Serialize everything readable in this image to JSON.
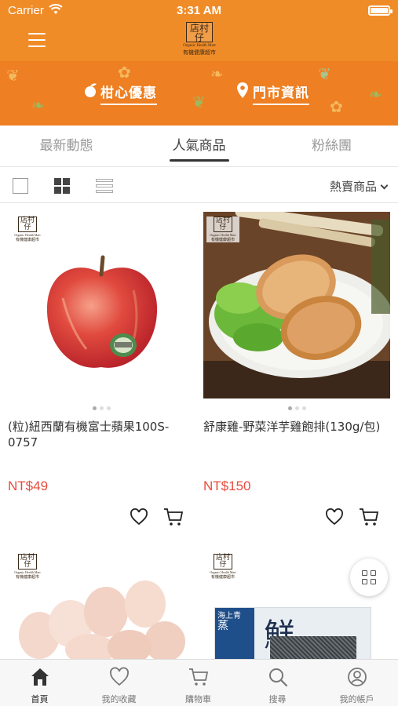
{
  "status_bar": {
    "carrier": "Carrier",
    "time": "3:31 AM"
  },
  "header": {
    "logo_mark": "店村仔",
    "logo_en": "Organic Health Mart",
    "logo_zh": "有機健康超市"
  },
  "banner": {
    "left_link": "柑心優惠",
    "right_link": "門市資訊"
  },
  "tabs": [
    {
      "label": "最新動態"
    },
    {
      "label": "人氣商品"
    },
    {
      "label": "粉絲團"
    }
  ],
  "active_tab": 1,
  "toolbar": {
    "sort_label": "熱賣商品"
  },
  "products": [
    {
      "name": "(粒)紐西蘭有機富士蘋果100S-0757",
      "price": "NT$49"
    },
    {
      "name": "舒康雞-野菜洋芋雞飽排(130g/包)",
      "price": "NT$150"
    },
    {
      "name": "",
      "price": ""
    },
    {
      "name": "",
      "price": ""
    }
  ],
  "package_label": {
    "brand": "海上青",
    "big_char": "鮮",
    "sub": "蒸"
  },
  "bottom_nav": [
    {
      "label": "首頁",
      "icon": "home-icon"
    },
    {
      "label": "我的收藏",
      "icon": "heart-icon"
    },
    {
      "label": "購物車",
      "icon": "cart-icon"
    },
    {
      "label": "搜尋",
      "icon": "search-icon"
    },
    {
      "label": "我的帳戶",
      "icon": "account-icon"
    }
  ],
  "colors": {
    "brand_orange": "#f08c28",
    "price_red": "#e84c3d"
  }
}
